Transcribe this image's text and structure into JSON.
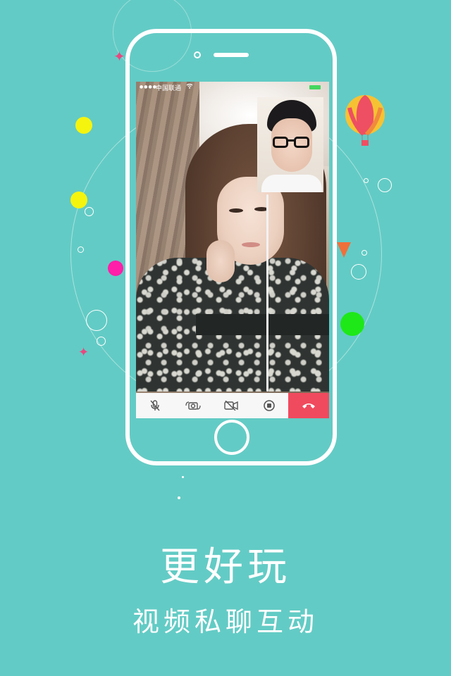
{
  "status_bar": {
    "signal": "●●●●○",
    "carrier": "中国联通",
    "wifi": "wifi-icon",
    "battery": "battery-icon"
  },
  "call_controls": [
    {
      "name": "mute-mic-button",
      "icon": "mic-off-icon"
    },
    {
      "name": "switch-camera-button",
      "icon": "camera-switch-icon"
    },
    {
      "name": "video-off-button",
      "icon": "video-off-icon"
    },
    {
      "name": "record-button",
      "icon": "record-icon"
    },
    {
      "name": "hang-up-button",
      "icon": "phone-hangup-icon"
    }
  ],
  "colors": {
    "background": "#63cbc5",
    "end_call": "#f04a5e",
    "battery": "#44d65e"
  },
  "promo": {
    "title": "更好玩",
    "subtitle": "视频私聊互动"
  }
}
